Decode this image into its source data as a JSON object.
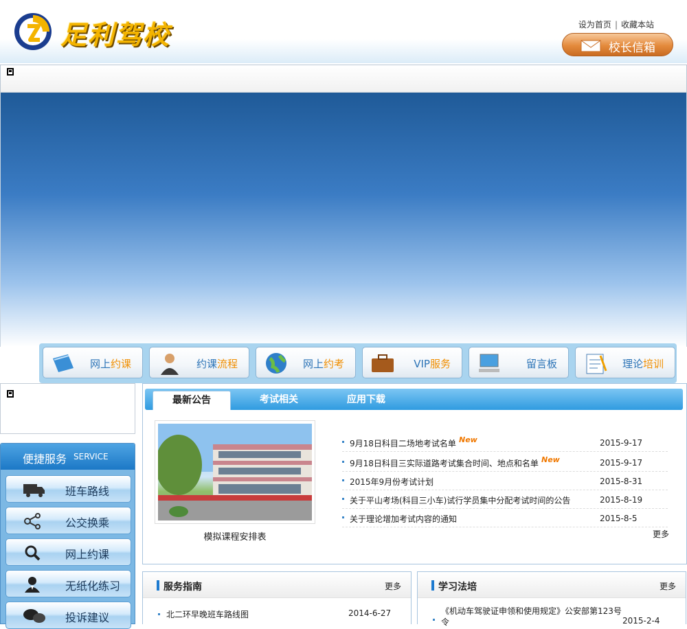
{
  "header": {
    "logo_text": "足利驾校",
    "set_home": "设为首页",
    "separator": "|",
    "bookmark": "收藏本站",
    "mailbox_button": "校长信箱"
  },
  "quick_nav": [
    {
      "plain": "网上",
      "highlight": "约课",
      "icon": "book-icon"
    },
    {
      "plain": "约课",
      "highlight": "流程",
      "icon": "person-icon"
    },
    {
      "plain": "网上",
      "highlight": "约考",
      "icon": "globe-icon"
    },
    {
      "plain": "VIP",
      "highlight": "服务",
      "icon": "briefcase-icon"
    },
    {
      "plain": "留言板",
      "highlight": "",
      "icon": "computer-icon"
    },
    {
      "plain": "理论",
      "highlight": "培训",
      "icon": "notepad-icon"
    }
  ],
  "service": {
    "title": "便捷服务",
    "subtitle": "SERVICE",
    "items": [
      {
        "label": "班车路线",
        "icon": "truck-icon"
      },
      {
        "label": "公交换乘",
        "icon": "share-icon"
      },
      {
        "label": "网上约课",
        "icon": "search-icon"
      },
      {
        "label": "无纸化练习",
        "icon": "person-icon"
      },
      {
        "label": "投诉建议",
        "icon": "chat-icon"
      }
    ]
  },
  "news": {
    "tabs": [
      "最新公告",
      "考试相关",
      "应用下载"
    ],
    "active_tab": 0,
    "photo_caption": "模拟课程安排表",
    "new_badge": "New",
    "items": [
      {
        "title": "9月18日科目二场地考试名单",
        "date": "2015-9-17",
        "is_new": true
      },
      {
        "title": "9月18日科目三实际道路考试集合时间、地点和名单",
        "date": "2015-9-17",
        "is_new": true
      },
      {
        "title": "2015年9月份考试计划",
        "date": "2015-8-31",
        "is_new": false
      },
      {
        "title": "关于平山考场(科目三小车)试行学员集中分配考试时间的公告",
        "date": "2015-8-19",
        "is_new": false
      },
      {
        "title": "关于理论增加考试内容的通知",
        "date": "2015-8-5",
        "is_new": false
      }
    ],
    "more": "更多"
  },
  "guide": {
    "title": "服务指南",
    "more": "更多",
    "items": [
      {
        "title": "北二环早晚班车路线图",
        "date": "2014-6-27"
      }
    ]
  },
  "law": {
    "title": "学习法培",
    "more": "更多",
    "items": [
      {
        "title": "《机动车驾驶证申领和使用规定》公安部第123号令",
        "date": "2015-2-4"
      }
    ]
  }
}
